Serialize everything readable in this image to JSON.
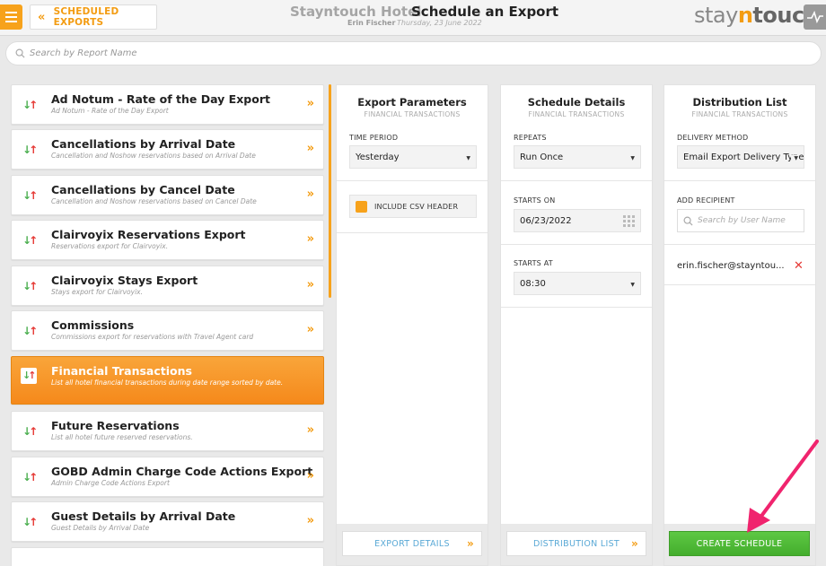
{
  "header": {
    "back_label": "SCHEDULED EXPORTS",
    "hotel_name": "Stayntouch Hotel",
    "page_title": "Schedule an Export",
    "user_name": "Erin Fischer",
    "date": "Thursday, 23 June 2022",
    "logo_pre": "stay",
    "logo_n": "n",
    "logo_post": "touch"
  },
  "search": {
    "placeholder": "Search by Report Name"
  },
  "reports": [
    {
      "title": "Ad Notum - Rate of the Day Export",
      "sub": "Ad Notum - Rate of the Day Export"
    },
    {
      "title": "Cancellations by Arrival Date",
      "sub": "Cancellation and Noshow reservations based on Arrival Date"
    },
    {
      "title": "Cancellations by Cancel Date",
      "sub": "Cancellation and Noshow reservations based on Cancel Date"
    },
    {
      "title": "Clairvoyix Reservations Export",
      "sub": "Reservations export for Clairvoyix."
    },
    {
      "title": "Clairvoyix Stays Export",
      "sub": "Stays export for Clairvoyix."
    },
    {
      "title": "Commissions",
      "sub": "Commissions export for reservations with Travel Agent card"
    },
    {
      "title": "Financial Transactions",
      "sub": "List all hotel financial transactions during date range sorted by date."
    },
    {
      "title": "Future Reservations",
      "sub": "List all hotel future reserved reservations."
    },
    {
      "title": "GOBD Admin Charge Code Actions Export",
      "sub": "Admin Charge Code Actions Export"
    },
    {
      "title": "Guest Details by Arrival Date",
      "sub": "Guest Details by Arrival Date"
    }
  ],
  "export_params": {
    "title": "Export Parameters",
    "sub": "FINANCIAL TRANSACTIONS",
    "time_period_label": "TIME PERIOD",
    "time_period_value": "Yesterday",
    "csv_header_label": "INCLUDE CSV HEADER",
    "footer_label": "EXPORT DETAILS"
  },
  "schedule_details": {
    "title": "Schedule Details",
    "sub": "FINANCIAL TRANSACTIONS",
    "repeats_label": "REPEATS",
    "repeats_value": "Run Once",
    "starts_on_label": "STARTS ON",
    "starts_on_value": "06/23/2022",
    "starts_at_label": "STARTS AT",
    "starts_at_value": "08:30",
    "footer_label": "DISTRIBUTION LIST"
  },
  "distribution": {
    "title": "Distribution List",
    "sub": "FINANCIAL TRANSACTIONS",
    "delivery_label": "DELIVERY METHOD",
    "delivery_value": "Email Export Delivery Type",
    "add_recipient_label": "ADD RECIPIENT",
    "search_user_placeholder": "Search by User Name",
    "recipient": "erin.fischer@stayntou...",
    "create_label": "CREATE SCHEDULE"
  },
  "colors": {
    "accent": "#f39c12",
    "create": "#4cb834",
    "arrow_annotation": "#f0246e"
  }
}
